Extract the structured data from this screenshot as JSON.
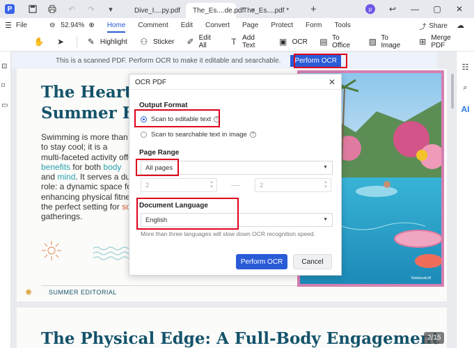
{
  "tabbar": {
    "tabs": [
      {
        "label": "Dive_I....py.pdf",
        "close": "×"
      },
      {
        "label": "The_Es....de.pdf",
        "close": "×"
      },
      {
        "label": "The_Es....pdf *",
        "close": "×"
      }
    ],
    "add": "+",
    "avatar": "p"
  },
  "menubar": {
    "file": "File",
    "zoom": "52.94%",
    "items": [
      "Home",
      "Comment",
      "Edit",
      "Convert",
      "Page",
      "Protect",
      "Form",
      "Tools"
    ],
    "share": "Share"
  },
  "toolbar": {
    "tools": [
      "Highlight",
      "Sticker",
      "Edit All",
      "Add Text",
      "OCR",
      "To Office",
      "To Image",
      "Merge PDF"
    ]
  },
  "ocr_notice": {
    "message": "This is a scanned PDF. Perform OCR to make it editable and searchable.",
    "button": "Perform OCR"
  },
  "document": {
    "page1_heading_line1": "The Heart of",
    "page1_heading_line2": "Summer Fu",
    "body_lines": [
      "Swimming is more than a w",
      "to stay cool; it is a",
      "multi-faceted activity offe"
    ],
    "body_benefits": "benefits",
    "body_for_both": " for both ",
    "body_body": "body",
    "body_and": "and ",
    "body_mind": "mind",
    "body_serves": ". It serves a dual",
    "body_line6": "role: a dynamic space for",
    "body_line7": "enhancing physical fitness",
    "body_line8_pre": "the perfect setting for ",
    "body_line8_soc": "soc",
    "body_line9": "gatherings.",
    "footer_label": "SUMMER EDITORIAL",
    "watermark": "NotebookLM",
    "page2_heading": "The Physical Edge: A Full-Body Engagement",
    "page_counter": "2/15"
  },
  "modal": {
    "title": "OCR PDF",
    "output_format_label": "Output Format",
    "option_editable": "Scan to editable text",
    "option_searchable": "Scan to searchable text in image",
    "page_range_label": "Page Range",
    "page_range_value": "All pages",
    "range_from": "2",
    "range_to": "2",
    "document_language_label": "Document Language",
    "language_value": "English",
    "hint": "More than three languages will slow down OCR recognition speed.",
    "perform_button": "Perform OCR",
    "cancel_button": "Cancel"
  },
  "colors": {
    "accent": "#2a5bd7",
    "annotation_red": "#e0001b",
    "heading": "#14536b",
    "highlight_teal": "#28a3b0"
  }
}
